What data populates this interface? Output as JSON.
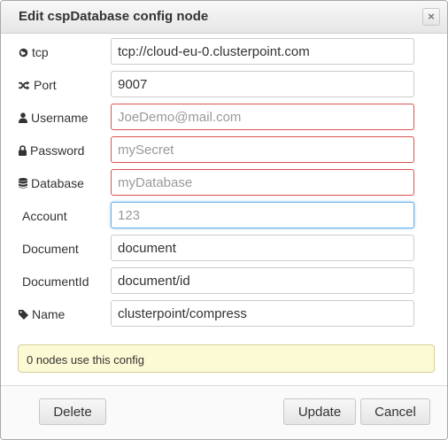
{
  "dialog": {
    "title": "Edit cspDatabase config node",
    "close_glyph": "×"
  },
  "fields": [
    {
      "label": "tcp",
      "icon": "globe-icon",
      "value": "tcp://cloud-eu-0.clusterpoint.com",
      "placeholder": ""
    },
    {
      "label": "Port",
      "icon": "random-icon",
      "value": "9007",
      "placeholder": ""
    },
    {
      "label": "Username",
      "icon": "user-icon",
      "value": "",
      "placeholder": "JoeDemo@mail.com"
    },
    {
      "label": "Password",
      "icon": "lock-icon",
      "value": "",
      "placeholder": "mySecret"
    },
    {
      "label": "Database",
      "icon": "database-icon",
      "value": "",
      "placeholder": "myDatabase"
    },
    {
      "label": "Account",
      "icon": "",
      "value": "",
      "placeholder": "123"
    },
    {
      "label": "Document",
      "icon": "",
      "value": "document",
      "placeholder": ""
    },
    {
      "label": "DocumentId",
      "icon": "",
      "value": "document/id",
      "placeholder": ""
    },
    {
      "label": "Name",
      "icon": "tag-icon",
      "value": "clusterpoint/compress",
      "placeholder": ""
    }
  ],
  "info": {
    "text": "0 nodes use this config"
  },
  "footer": {
    "delete_label": "Delete",
    "update_label": "Update",
    "cancel_label": "Cancel"
  },
  "colors": {
    "error_border": "#d9534f",
    "focus_border": "#66afe9",
    "info_background": "#fcfad4"
  }
}
